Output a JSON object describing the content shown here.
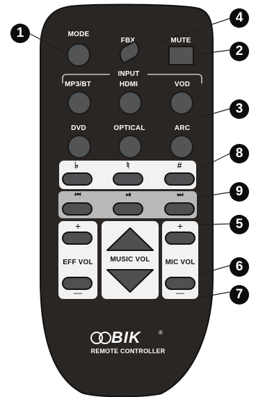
{
  "remote": {
    "labels": {
      "mode": "MODE",
      "fbx": "FBX",
      "mute": "MUTE",
      "input": "INPUT",
      "mp3bt": "MP3/BT",
      "hdmi": "HDMI",
      "vod": "VOD",
      "dvd": "DVD",
      "optical": "OPTICAL",
      "arc": "ARC",
      "eff_vol": "EFF VOL",
      "music_vol": "MUSIC VOL",
      "mic_vol": "MIC VOL"
    },
    "pitch_symbols": {
      "flat": "♭",
      "natural": "♮",
      "sharp": "#"
    },
    "transport_symbols": {
      "prev": "⏮",
      "play_pause": "⏯",
      "next": "⏭"
    },
    "vol_symbols": {
      "plus": "+",
      "minus": "—"
    },
    "brand": {
      "logo_text": "BIK",
      "registered": "®",
      "tagline": "REMOTE CONTROLLER"
    }
  },
  "callouts": [
    "1",
    "2",
    "3",
    "4",
    "5",
    "6",
    "7",
    "8",
    "9"
  ],
  "colors": {
    "body": "#2a2624",
    "button": "#535456",
    "panel_white": "#f2f2f2",
    "panel_grey": "#b9b9b9",
    "callout": "#0c0c0c"
  }
}
